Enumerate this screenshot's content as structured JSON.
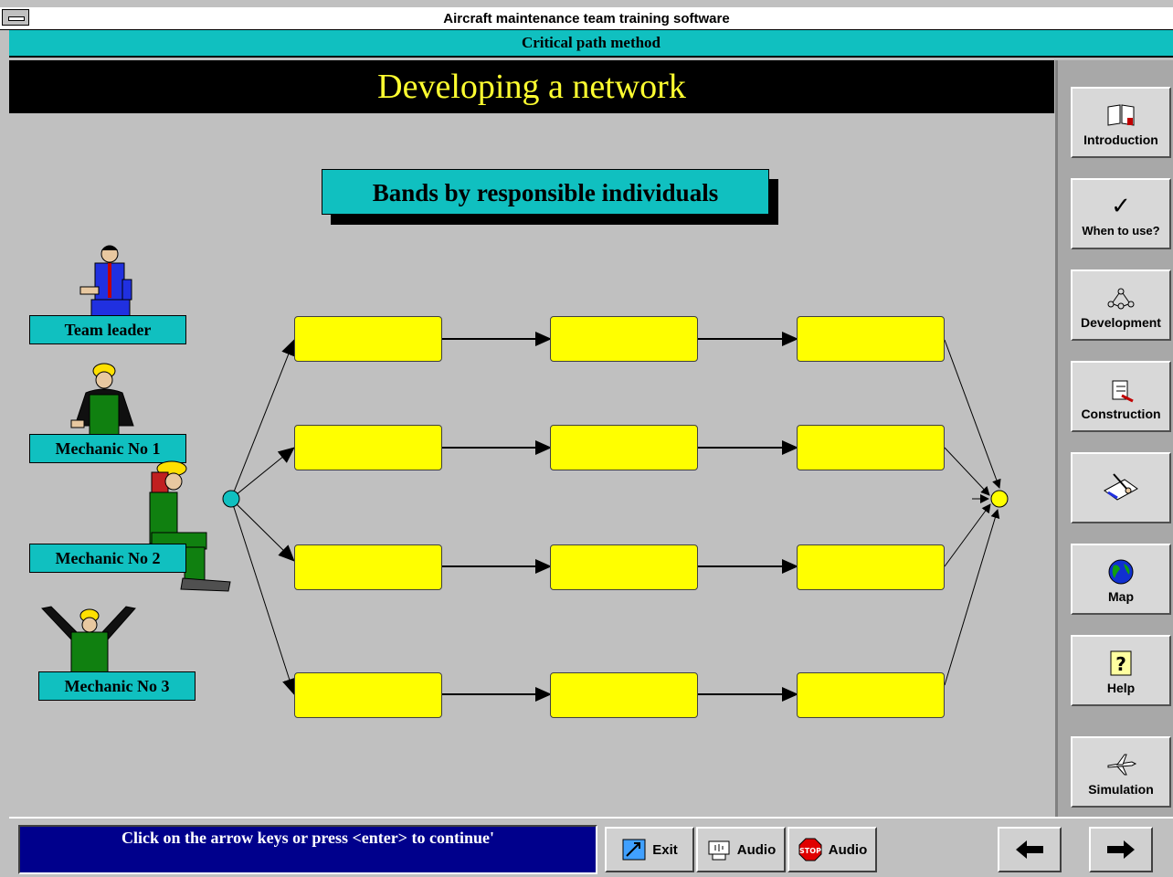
{
  "window": {
    "title": "Aircraft maintenance team training software"
  },
  "module": {
    "subtitle": "Critical path method"
  },
  "page": {
    "title": "Developing a network"
  },
  "band_label": "Bands by responsible individuals",
  "people": [
    {
      "label": "Team leader",
      "icon": "team-leader-figure"
    },
    {
      "label": "Mechanic No 1",
      "icon": "mechanic-figure"
    },
    {
      "label": "Mechanic No 2",
      "icon": "seated-mechanic-figure"
    },
    {
      "label": "Mechanic No 3",
      "icon": "waving-mechanic-figure"
    }
  ],
  "network": {
    "rows": 4,
    "activities_per_row": 3,
    "start_node_color": "#10c0c0",
    "end_node_color": "#ffff00",
    "activity_color": "#ffff00"
  },
  "nav": [
    {
      "label": "Introduction",
      "icon": "book-icon"
    },
    {
      "label": "When to use?",
      "icon": "checkmark-icon"
    },
    {
      "label": "Development",
      "icon": "network-icon"
    },
    {
      "label": "Construction",
      "icon": "construction-icon"
    },
    {
      "label": "",
      "icon": "writing-icon"
    },
    {
      "label": "Map",
      "icon": "globe-icon"
    },
    {
      "label": "Help",
      "icon": "help-icon"
    },
    {
      "label": "Simulation",
      "icon": "airplane-icon"
    }
  ],
  "status_text": "Click on the arrow keys or press <enter> to continue'",
  "bottom_buttons": [
    {
      "label": "Exit",
      "icon": "exit-icon"
    },
    {
      "label": "Audio",
      "icon": "audio-icon"
    },
    {
      "label": "Audio",
      "icon": "stop-icon"
    }
  ],
  "colors": {
    "accent": "#10c0c0",
    "header_bg": "#000000",
    "header_text": "#ffff30",
    "status_bg": "#00008c"
  }
}
